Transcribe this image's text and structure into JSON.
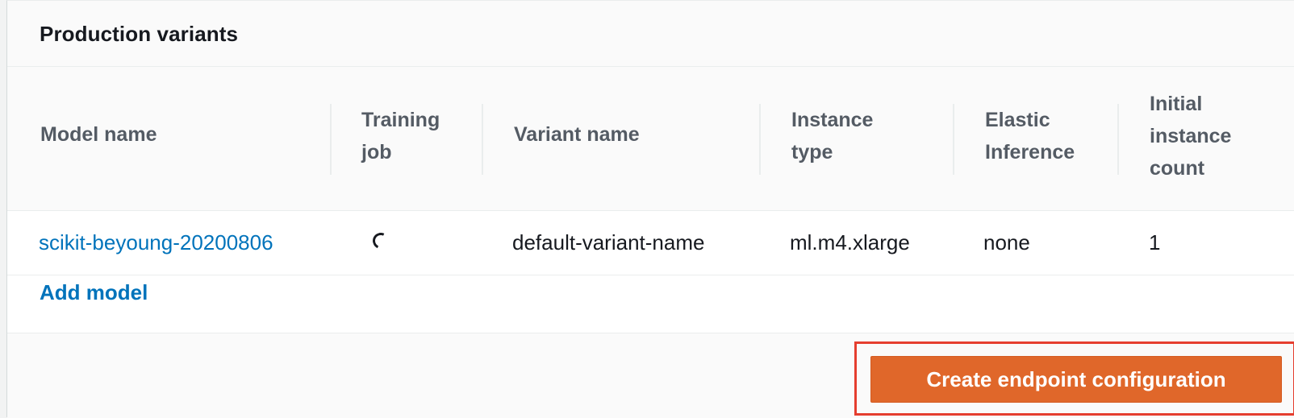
{
  "panel": {
    "title": "Production variants"
  },
  "table": {
    "columns": [
      "Model name",
      "Training\njob",
      "Variant name",
      "Instance\ntype",
      "Elastic\nInference",
      "Initial\ninstance\ncount"
    ],
    "rows": [
      {
        "model_name": "scikit-beyoung-20200806",
        "training_job_icon": "loading-spinner-icon",
        "variant_name": "default-variant-name",
        "instance_type": "ml.m4.xlarge",
        "elastic_inference": "none",
        "initial_instance_count": "1"
      }
    ],
    "add_model_label": "Add model"
  },
  "footer": {
    "create_button_label": "Create endpoint configuration",
    "highlight_color": "#e53e2f",
    "button_color": "#e0672a"
  },
  "colors": {
    "link": "#0073bb",
    "header_text": "#545b64",
    "body_text": "#16191f"
  }
}
